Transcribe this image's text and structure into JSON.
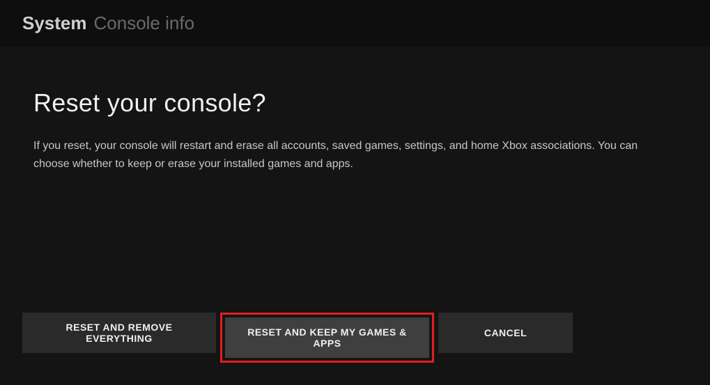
{
  "header": {
    "primary": "System",
    "secondary": "Console info"
  },
  "dialog": {
    "title": "Reset your console?",
    "description": "If you reset, your console will restart and erase all accounts, saved games, settings, and home Xbox associations. You can choose whether to keep or erase your installed games and apps."
  },
  "buttons": {
    "reset_all": "RESET AND REMOVE EVERYTHING",
    "reset_keep": "RESET AND KEEP MY GAMES & APPS",
    "cancel": "CANCEL"
  }
}
